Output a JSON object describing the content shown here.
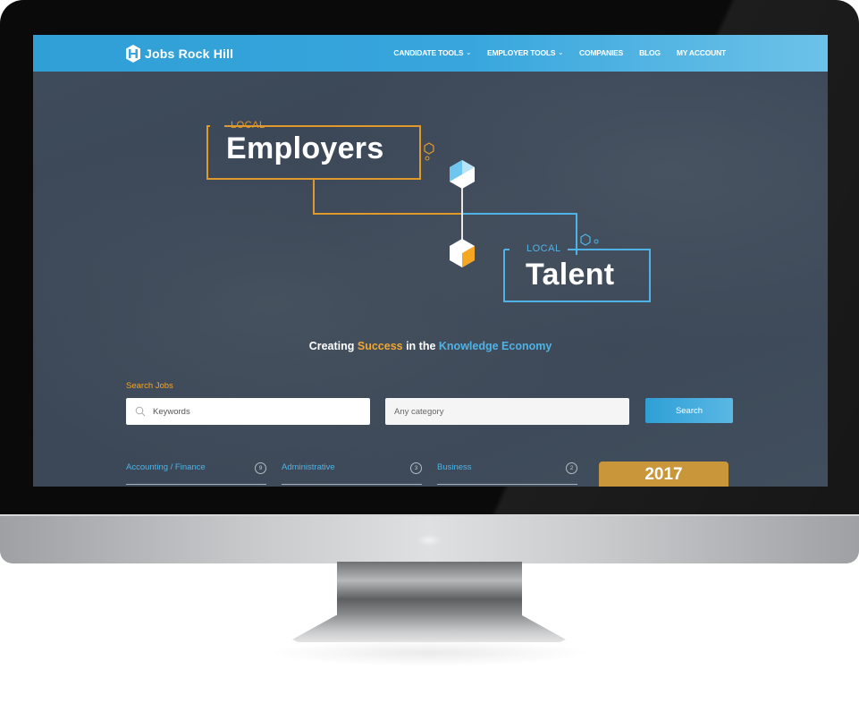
{
  "header": {
    "logo_text": "Jobs Rock Hill",
    "nav": [
      {
        "label": "CANDIDATE TOOLS",
        "has_dropdown": true
      },
      {
        "label": "EMPLOYER TOOLS",
        "has_dropdown": true
      },
      {
        "label": "COMPANIES",
        "has_dropdown": false
      },
      {
        "label": "BLOG",
        "has_dropdown": false
      },
      {
        "label": "MY ACCOUNT",
        "has_dropdown": false
      }
    ],
    "dropdown_glyph": "⌄"
  },
  "hero": {
    "employers_prefix": "LOCAL",
    "employers_word": "Employers",
    "talent_prefix": "LOCAL",
    "talent_word": "Talent",
    "tagline": {
      "part1": "Creating ",
      "highlight1": "Success",
      "part2": " in the ",
      "highlight2": "Knowledge Economy"
    }
  },
  "search": {
    "label": "Search Jobs",
    "keywords_placeholder": "Keywords",
    "category_placeholder": "Any category",
    "button_label": "Search"
  },
  "categories": [
    {
      "name": "Accounting / Finance",
      "count": "9"
    },
    {
      "name": "Administrative",
      "count": "3"
    },
    {
      "name": "Business",
      "count": "2"
    }
  ],
  "year_badge": "2017",
  "colors": {
    "brand_blue": "#38a6dd",
    "accent_orange": "#f0a630",
    "badge_gold": "#c9963a",
    "background_slate": "#3d4958"
  }
}
